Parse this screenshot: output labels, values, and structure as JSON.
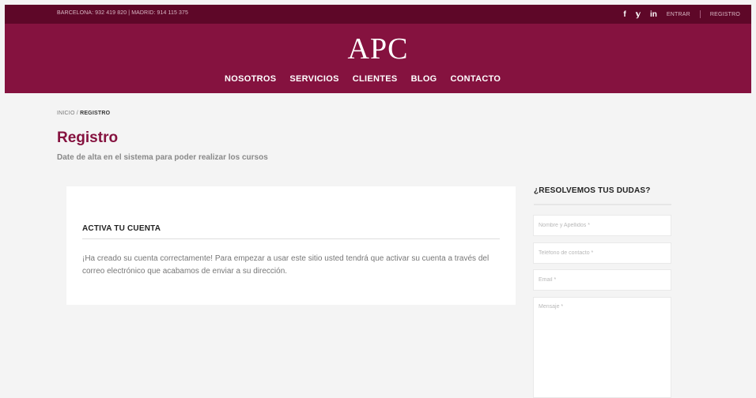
{
  "topbar": {
    "phones": "BARCELONA: 932 419 820 | MADRID: 914 115 375",
    "social": {
      "facebook": "f",
      "twitter": "𝕪",
      "linkedin": "in"
    },
    "login_label": "ENTRAR",
    "register_label": "REGISTRO"
  },
  "header": {
    "logo": "APC",
    "nav": [
      "NOSOTROS",
      "SERVICIOS",
      "CLIENTES",
      "BLOG",
      "CONTACTO"
    ]
  },
  "breadcrumb": {
    "home": "INICIO",
    "separator": "/",
    "current": "REGISTRO"
  },
  "page": {
    "title": "Registro",
    "subtitle": "Date de alta en el sistema para poder realizar los cursos"
  },
  "card": {
    "title": "ACTIVA TU CUENTA",
    "message": "¡Ha creado su cuenta correctamente! Para empezar a usar este sitio usted tendrá que activar su cuenta a través del correo electrónico que acabamos de enviar a su dirección."
  },
  "sidebar": {
    "title": "¿RESOLVEMOS TUS DUDAS?",
    "fields": {
      "name_placeholder": "Nombre y Apellidos *",
      "phone_placeholder": "Teléfono de contacto *",
      "email_placeholder": "Email *",
      "message_placeholder": "Mensaje *"
    }
  },
  "colors": {
    "topbar": "#5e0728",
    "header": "#85123f",
    "accent": "#85123f",
    "background": "#f4f4f4"
  }
}
